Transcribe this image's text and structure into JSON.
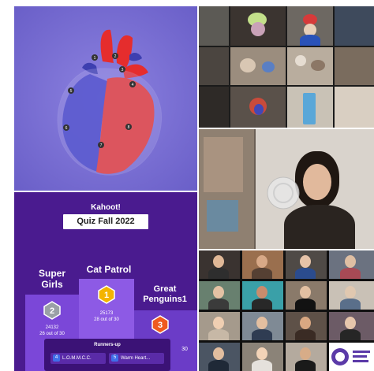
{
  "kahoot": {
    "logo": "Kahoot!",
    "title": "Quiz Fall 2022",
    "first": {
      "team": "Cat Patrol",
      "rank": "1",
      "points": "25173",
      "correct": "28 out of 30"
    },
    "second": {
      "team": "Super Girls",
      "rank": "2",
      "points": "24132",
      "correct": "26 out of 30"
    },
    "third": {
      "team": "Great Penguins1",
      "rank": "3",
      "correct": "30"
    },
    "runners_up_title": "Runners-up",
    "runners_up": [
      {
        "num": "4",
        "name": "L.O.M.M.C.C."
      },
      {
        "num": "5",
        "name": "Warm Heart..."
      }
    ]
  },
  "colors": {
    "heart_bg": "#7d72d6",
    "kahoot_bg": "#4a1b8f",
    "accent_gold": "#f4b400",
    "accent_orange": "#ef5a1f"
  },
  "heart_labels": [
    "1",
    "2",
    "3",
    "4",
    "5",
    "6",
    "7",
    "8"
  ]
}
